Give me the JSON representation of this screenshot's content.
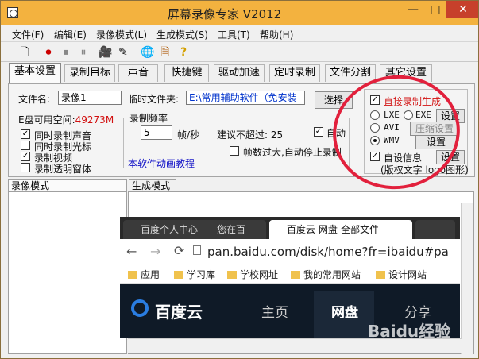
{
  "window": {
    "title": "屏幕录像专家 V2012"
  },
  "window_controls": {
    "min": "—",
    "max": "□",
    "close": "✕"
  },
  "menu": [
    "文件(F)",
    "编辑(E)",
    "录像模式(L)",
    "生成模式(S)",
    "工具(T)",
    "帮助(H)"
  ],
  "toolbar_icons": [
    "new-icon",
    "record-icon",
    "stop-icon",
    "pause-icon",
    "stop2-icon",
    "camera-icon",
    "pen-icon",
    "globe-icon",
    "export-icon",
    "help-icon"
  ],
  "toolbar_glyphs": [
    "🗋",
    "⏺",
    "⏹",
    "⏸",
    "⏹",
    "🎥",
    "✎",
    "🌐",
    "🗎",
    "?"
  ],
  "tabs": [
    "基本设置",
    "录制目标",
    "声音",
    "快捷键",
    "驱动加速",
    "定时录制",
    "文件分割",
    "其它设置"
  ],
  "basic": {
    "file_name_label": "文件名:",
    "file_name_value": "录像1",
    "temp_folder_label": "临时文件夹:",
    "temp_folder_value": "E:\\常用辅助软件（免安装",
    "select_button": "选择",
    "disk_space_label": "E盘可用空间:",
    "disk_space_value": "49273M",
    "checks": [
      {
        "label": "同时录制声音",
        "checked": true
      },
      {
        "label": "同时录制光标",
        "checked": false
      },
      {
        "label": "录制视频",
        "checked": true
      },
      {
        "label": "录制透明窗体",
        "checked": false
      }
    ],
    "frame_rate_title": "录制频率",
    "frame_rate_value": "5",
    "frame_rate_unit": "帧/秒",
    "suggest_label": "建议不超过: 25",
    "auto_label": "自动",
    "auto_checked": true,
    "auto_stop_label": "帧数过大,自动停止录制",
    "auto_stop_checked": false,
    "tutorial_link": "本软件动画教程",
    "direct_record_label": "直接录制生成",
    "direct_record_checked": true,
    "formats": [
      {
        "label": "LXE",
        "selected": false
      },
      {
        "label": "EXE",
        "selected": false
      },
      {
        "label": "AVI",
        "selected": false
      },
      {
        "label": "WMV",
        "selected": true
      }
    ],
    "settings_button": "设置",
    "compress_button": "压缩设置",
    "wmv_settings_button": "设置",
    "auto_info_label": "自设信息",
    "auto_info_checked": true,
    "auto_info_button": "设置",
    "copyright_text": "(版权文字 logo图形)"
  },
  "lower": {
    "left_tab": "录像模式",
    "right_tab": "生成模式"
  },
  "browser": {
    "tab1": "百度个人中心——您在百",
    "tab2": "百度云 网盘-全部文件",
    "url": "pan.baidu.com/disk/home?fr=ibaidu#pa",
    "bookmarks": [
      "应用",
      "学习库",
      "学校网址",
      "我的常用网站",
      "设计网站"
    ],
    "baidu_logo": "百度云",
    "nav": [
      "主页",
      "网盘",
      "分享"
    ]
  },
  "watermark": "Baidu经验"
}
